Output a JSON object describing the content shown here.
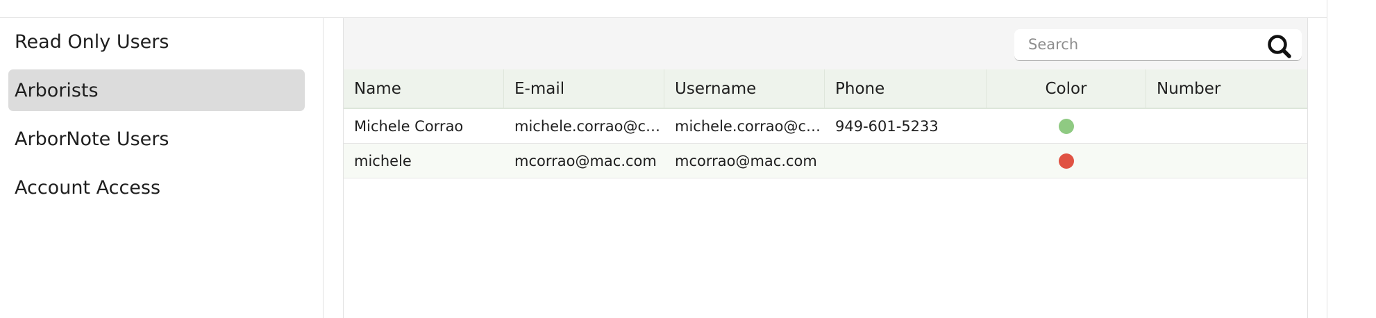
{
  "sidebar": {
    "items": [
      {
        "label": "Read Only Users",
        "active": false
      },
      {
        "label": "Arborists",
        "active": true
      },
      {
        "label": "ArborNote Users",
        "active": false
      },
      {
        "label": "Account Access",
        "active": false
      }
    ]
  },
  "search": {
    "placeholder": "Search",
    "value": ""
  },
  "table": {
    "columns": [
      "Name",
      "E-mail",
      "Username",
      "Phone",
      "Color",
      "Number"
    ],
    "rows": [
      {
        "name": "Michele Corrao",
        "email": "michele.corrao@c…",
        "username": "michele.corrao@c…",
        "phone": "949-601-5233",
        "color": "#8fca82",
        "number": ""
      },
      {
        "name": "michele",
        "email": "mcorrao@mac.com",
        "username": "mcorrao@mac.com",
        "phone": "",
        "color": "#e05243",
        "number": ""
      }
    ]
  },
  "icons": {
    "search": "search-icon"
  }
}
